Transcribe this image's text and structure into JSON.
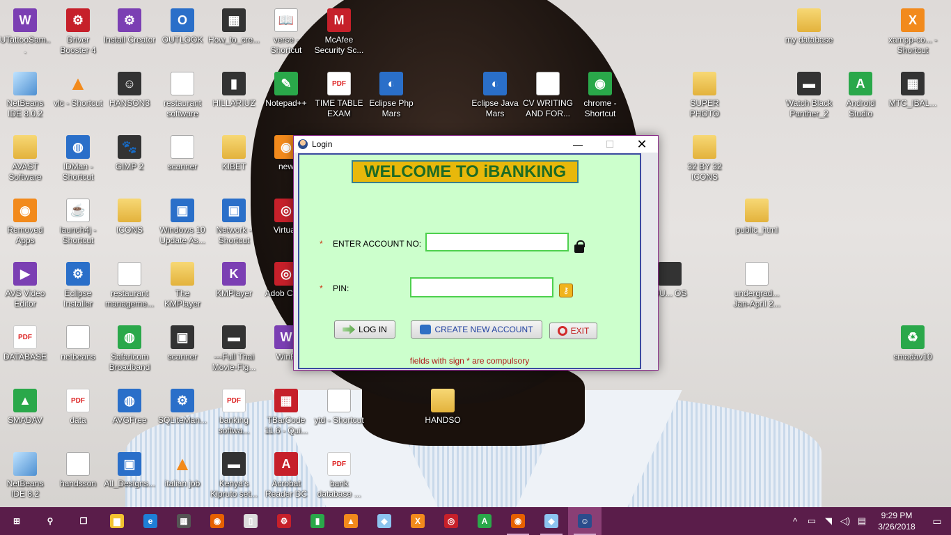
{
  "desktop": {
    "icons": [
      {
        "label": "UTattooSam...",
        "kind": "purple",
        "glyph": "W"
      },
      {
        "label": "Driver Booster 4",
        "kind": "red",
        "glyph": "⚙"
      },
      {
        "label": "Install Creator",
        "kind": "purple",
        "glyph": "⚙"
      },
      {
        "label": "OUTLOOK",
        "kind": "blue",
        "glyph": "O"
      },
      {
        "label": "How_to_cre...",
        "kind": "dark",
        "glyph": "▦"
      },
      {
        "label": "verse - Shortcut",
        "kind": "doc",
        "glyph": "📖"
      },
      {
        "label": "McAfee Security Sc...",
        "kind": "red",
        "glyph": "M"
      },
      {
        "label": "my database",
        "kind": "folder",
        "glyph": ""
      },
      {
        "label": "xampp-co... - Shortcut",
        "kind": "orange",
        "glyph": "X"
      },
      {
        "label": "NetBeans IDE 8.0.2",
        "kind": "cube",
        "glyph": ""
      },
      {
        "label": "vlc - Shortcut",
        "kind": "vlc",
        "glyph": "▲"
      },
      {
        "label": "HANSON3",
        "kind": "dark",
        "glyph": "☺"
      },
      {
        "label": "restaurant software",
        "kind": "doc",
        "glyph": "☎"
      },
      {
        "label": "HILLARIUZ",
        "kind": "dark",
        "glyph": "▮"
      },
      {
        "label": "Notepad++",
        "kind": "green",
        "glyph": "✎"
      },
      {
        "label": "TIME TABLE EXAM",
        "kind": "pdf",
        "glyph": "PDF"
      },
      {
        "label": "Eclipse Php Mars",
        "kind": "blue",
        "glyph": "◐"
      },
      {
        "label": "Eclipse Java Mars",
        "kind": "blue",
        "glyph": "◐"
      },
      {
        "label": "CV WRITING AND FOR...",
        "kind": "doc",
        "glyph": "W"
      },
      {
        "label": "chrome - Shortcut",
        "kind": "green",
        "glyph": "◉"
      },
      {
        "label": "SUPER PHOTO",
        "kind": "folder",
        "glyph": ""
      },
      {
        "label": "Watch Black Panther_2",
        "kind": "dark",
        "glyph": "▬"
      },
      {
        "label": "Android Studio",
        "kind": "green",
        "glyph": "A"
      },
      {
        "label": "MTC_IBAL...",
        "kind": "dark",
        "glyph": "▦"
      },
      {
        "label": "AVAST Software",
        "kind": "folder",
        "glyph": ""
      },
      {
        "label": "IDMan - Shortcut",
        "kind": "blue",
        "glyph": "◍"
      },
      {
        "label": "GIMP 2",
        "kind": "dark",
        "glyph": "🐾"
      },
      {
        "label": "scanner",
        "kind": "doc",
        "glyph": "⚙"
      },
      {
        "label": "KIBET",
        "kind": "folder",
        "glyph": ""
      },
      {
        "label": "new",
        "kind": "orange",
        "glyph": "◉"
      },
      {
        "label": "32 BY 32 ICONS",
        "kind": "folder",
        "glyph": ""
      },
      {
        "label": "Removed Apps",
        "kind": "orange",
        "glyph": "◉"
      },
      {
        "label": "launch4j - Shortcut",
        "kind": "doc",
        "glyph": "☕"
      },
      {
        "label": "ICONS",
        "kind": "folder",
        "glyph": ""
      },
      {
        "label": "Windows 10 Update As...",
        "kind": "blue",
        "glyph": "▣"
      },
      {
        "label": "Network - Shortcut",
        "kind": "blue",
        "glyph": "▣"
      },
      {
        "label": "Virtuall",
        "kind": "red",
        "glyph": "◎"
      },
      {
        "label": "public_html",
        "kind": "folder",
        "glyph": ""
      },
      {
        "label": "AVS Video Editor",
        "kind": "purple",
        "glyph": "▶"
      },
      {
        "label": "Eclipse Installer",
        "kind": "blue",
        "glyph": "⚙"
      },
      {
        "label": "restaurant manageme...",
        "kind": "doc",
        "glyph": ""
      },
      {
        "label": "The KMPlayer",
        "kind": "folder",
        "glyph": ""
      },
      {
        "label": "KMPlayer",
        "kind": "purple",
        "glyph": "K"
      },
      {
        "label": "Adob Creat",
        "kind": "red",
        "glyph": "◎"
      },
      {
        "label": "OU... OS",
        "kind": "dark",
        "glyph": ""
      },
      {
        "label": "undergrad... Jan-April 2...",
        "kind": "doc",
        "glyph": "W"
      },
      {
        "label": "DATABASE",
        "kind": "pdf",
        "glyph": "PDF"
      },
      {
        "label": "netbeans",
        "kind": "doc",
        "glyph": ""
      },
      {
        "label": "Safaricom Broadband",
        "kind": "green",
        "glyph": "◍"
      },
      {
        "label": "scanner",
        "kind": "dark",
        "glyph": "▣"
      },
      {
        "label": "---Full Thai Movie-Fig...",
        "kind": "dark",
        "glyph": "▬"
      },
      {
        "label": "WinR",
        "kind": "purple",
        "glyph": "W"
      },
      {
        "label": "smadav10",
        "kind": "green",
        "glyph": "♻"
      },
      {
        "label": "SMADAV",
        "kind": "green",
        "glyph": "▲"
      },
      {
        "label": "data",
        "kind": "pdf",
        "glyph": "PDF"
      },
      {
        "label": "AVGFree",
        "kind": "blue",
        "glyph": "◍"
      },
      {
        "label": "SQLiteMan...",
        "kind": "blue",
        "glyph": "⚙"
      },
      {
        "label": "banking softwa...",
        "kind": "pdf",
        "glyph": "PDF"
      },
      {
        "label": "TBarCode 11.6 - Qui...",
        "kind": "red",
        "glyph": "▦"
      },
      {
        "label": "ytd - Shortcut",
        "kind": "doc",
        "glyph": ""
      },
      {
        "label": "HANDSO",
        "kind": "folder",
        "glyph": ""
      },
      {
        "label": "NetBeans IDE 8.2",
        "kind": "cube",
        "glyph": ""
      },
      {
        "label": "handsson",
        "kind": "doc",
        "glyph": ""
      },
      {
        "label": "All_Designs...",
        "kind": "blue",
        "glyph": "▣"
      },
      {
        "label": "italian job",
        "kind": "vlc",
        "glyph": "▲"
      },
      {
        "label": "Kenya's Kipruto set...",
        "kind": "dark",
        "glyph": "▬"
      },
      {
        "label": "Acrobat Reader DC",
        "kind": "red",
        "glyph": "A"
      },
      {
        "label": "bank database ...",
        "kind": "pdf",
        "glyph": "PDF"
      }
    ]
  },
  "window": {
    "title": "Login",
    "minimize_glyph": "—",
    "maximize_glyph": "☐",
    "close_glyph": "✕",
    "welcome_text": "WELCOME TO iBANKING",
    "account_label": "ENTER ACCOUNT NO:",
    "account_value": "",
    "pin_label": "PIN:",
    "pin_value": "",
    "required_marker": "*",
    "login_button": "LOG IN",
    "create_button": "CREATE NEW ACCOUNT",
    "exit_button": "EXIT",
    "footnote": "fields with sign * are compulsory",
    "colors": {
      "panel_bg": "#ccffcc",
      "welcome_bg": "#e8b80b",
      "welcome_text": "#1d6b25",
      "input_border": "#4ed04e",
      "footnote": "#b21a1a"
    }
  },
  "taskbar": {
    "color": "#5a1d4a",
    "items": [
      {
        "name": "start-button",
        "icon": "windows-logo",
        "glyph": "⊞"
      },
      {
        "name": "search-button",
        "icon": "search-icon",
        "glyph": "⚲"
      },
      {
        "name": "task-view-button",
        "icon": "task-view-icon",
        "glyph": "❐"
      },
      {
        "name": "file-explorer",
        "icon": "folder-icon",
        "glyph": "▆"
      },
      {
        "name": "edge",
        "icon": "edge-icon",
        "glyph": "e"
      },
      {
        "name": "store",
        "icon": "store-icon",
        "glyph": "▦"
      },
      {
        "name": "firefox",
        "icon": "firefox-icon",
        "glyph": "◉"
      },
      {
        "name": "notepad",
        "icon": "document-icon",
        "glyph": "▯"
      },
      {
        "name": "driver-booster",
        "icon": "gear-icon",
        "glyph": "⚙"
      },
      {
        "name": "green-app",
        "icon": "pipe-icon",
        "glyph": "▮"
      },
      {
        "name": "vlc",
        "icon": "cone-icon",
        "glyph": "▲"
      },
      {
        "name": "netbeans",
        "icon": "cube-icon",
        "glyph": "◆"
      },
      {
        "name": "xampp",
        "icon": "xampp-icon",
        "glyph": "X"
      },
      {
        "name": "creative-cloud",
        "icon": "creative-cloud-icon",
        "glyph": "◎"
      },
      {
        "name": "android-studio",
        "icon": "android-icon",
        "glyph": "A"
      },
      {
        "name": "firefox-running",
        "icon": "firefox-icon",
        "glyph": "◉"
      },
      {
        "name": "netbeans-running",
        "icon": "cube-icon",
        "glyph": "◆"
      },
      {
        "name": "login-app",
        "icon": "user-icon",
        "glyph": "☺"
      }
    ],
    "tray": {
      "chevron": "^",
      "time": "9:29 PM",
      "date": "3/26/2018"
    }
  }
}
